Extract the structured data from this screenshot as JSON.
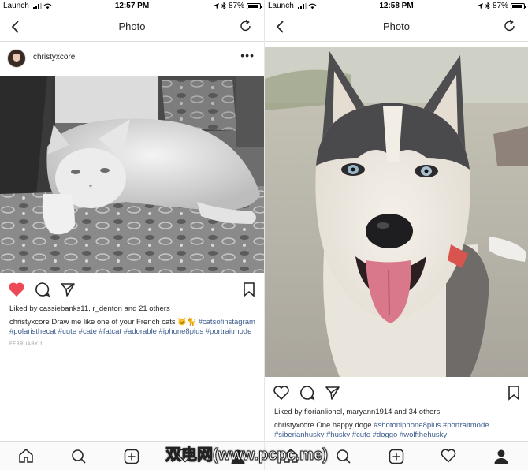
{
  "left": {
    "status": {
      "carrier": "Launch",
      "time": "12:57 PM",
      "battery": "87%"
    },
    "nav": {
      "title": "Photo"
    },
    "post": {
      "username": "christyxcore",
      "liked_by_prefix": "Liked by ",
      "liked_users": "cassiebanks11, r_denton",
      "liked_suffix": " and 21 others",
      "caption_user": "christyxcore",
      "caption_text": " Draw me like one of your French cats 🐱🐈",
      "hashtags": "#catsofinstagram #polaristhecat #cute #cate #fatcat #adorable #iphone8plus #portraitmode",
      "date": "FEBRUARY 1"
    }
  },
  "right": {
    "status": {
      "carrier": "Launch",
      "time": "12:58 PM",
      "battery": "87%"
    },
    "nav": {
      "title": "Photo"
    },
    "post": {
      "liked_by_prefix": "Liked by ",
      "liked_users": "florianlionel, maryann1914",
      "liked_suffix": " and 34 others",
      "caption_user": "christyxcore",
      "caption_text": " One happy doge ",
      "hashtags": "#shotoniphone8plus #portraitmode #siberianhusky #husky #cute #doggo #wolfthehusky"
    }
  },
  "watermark": "双电网(www.pcpc.me)",
  "colors": {
    "like_red": "#ed4956",
    "hashtag_blue": "#3b5b8c",
    "border": "#dbdbdb"
  }
}
